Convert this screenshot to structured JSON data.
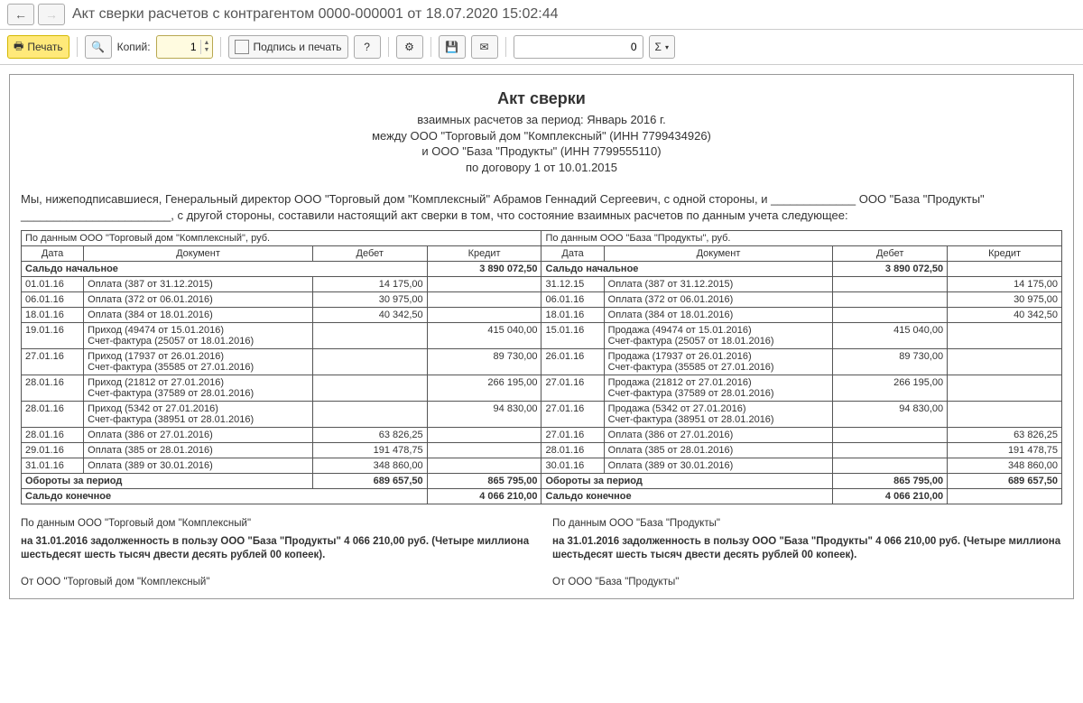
{
  "titlebar": {
    "title": "Акт сверки расчетов с контрагентом 0000-000001 от 18.07.2020 15:02:44"
  },
  "toolbar": {
    "print_label": "Печать",
    "copies_label": "Копий:",
    "copies_value": "1",
    "sign_label": "Подпись и печать",
    "num_value": "0",
    "sigma": "Σ"
  },
  "doc": {
    "title": "Акт сверки",
    "sub1": "взаимных расчетов за период: Январь 2016 г.",
    "sub2": "между ООО \"Торговый дом \"Комплексный\" (ИНН 7799434926)",
    "sub3": "и ООО \"База \"Продукты\" (ИНН 7799555110)",
    "sub4": "по договору 1 от 10.01.2015",
    "intro": "Мы, нижеподписавшиеся, Генеральный директор ООО \"Торговый дом \"Комплексный\" Абрамов Геннадий Сергеевич, с одной стороны, и _____________ ООО \"База \"Продукты\" _______________________, с другой стороны, составили настоящий акт сверки в том, что состояние взаимных расчетов по данным учета следующее:"
  },
  "table": {
    "left_header": "По данным ООО \"Торговый дом \"Комплексный\", руб.",
    "right_header": "По данным ООО \"База \"Продукты\", руб.",
    "col_date": "Дата",
    "col_doc": "Документ",
    "col_debit": "Дебет",
    "col_credit": "Кредит",
    "opening_label": "Сальдо начальное",
    "opening_left": "3 890 072,50",
    "opening_right": "3 890 072,50",
    "rows": [
      {
        "ld": "01.01.16",
        "ldoc": "Оплата (387 от 31.12.2015)",
        "ldeb": "14 175,00",
        "lcred": "",
        "rd": "31.12.15",
        "rdoc": "Оплата (387 от 31.12.2015)",
        "rdeb": "",
        "rcred": "14 175,00"
      },
      {
        "ld": "06.01.16",
        "ldoc": "Оплата (372 от 06.01.2016)",
        "ldeb": "30 975,00",
        "lcred": "",
        "rd": "06.01.16",
        "rdoc": "Оплата (372 от 06.01.2016)",
        "rdeb": "",
        "rcred": "30 975,00"
      },
      {
        "ld": "18.01.16",
        "ldoc": "Оплата (384 от 18.01.2016)",
        "ldeb": "40 342,50",
        "lcred": "",
        "rd": "18.01.16",
        "rdoc": "Оплата (384 от 18.01.2016)",
        "rdeb": "",
        "rcred": "40 342,50"
      },
      {
        "ld": "19.01.16",
        "ldoc": "Приход (49474 от 15.01.2016)\nСчет-фактура (25057 от 18.01.2016)",
        "ldeb": "",
        "lcred": "415 040,00",
        "rd": "15.01.16",
        "rdoc": "Продажа (49474 от 15.01.2016)\nСчет-фактура (25057 от 18.01.2016)",
        "rdeb": "415 040,00",
        "rcred": ""
      },
      {
        "ld": "27.01.16",
        "ldoc": "Приход (17937 от 26.01.2016)\nСчет-фактура (35585 от 27.01.2016)",
        "ldeb": "",
        "lcred": "89 730,00",
        "rd": "26.01.16",
        "rdoc": "Продажа (17937 от 26.01.2016)\nСчет-фактура (35585 от 27.01.2016)",
        "rdeb": "89 730,00",
        "rcred": ""
      },
      {
        "ld": "28.01.16",
        "ldoc": "Приход (21812 от 27.01.2016)\nСчет-фактура (37589 от 28.01.2016)",
        "ldeb": "",
        "lcred": "266 195,00",
        "rd": "27.01.16",
        "rdoc": "Продажа (21812 от 27.01.2016)\nСчет-фактура (37589 от 28.01.2016)",
        "rdeb": "266 195,00",
        "rcred": ""
      },
      {
        "ld": "28.01.16",
        "ldoc": "Приход (5342 от 27.01.2016)\nСчет-фактура (38951 от 28.01.2016)",
        "ldeb": "",
        "lcred": "94 830,00",
        "rd": "27.01.16",
        "rdoc": "Продажа (5342 от 27.01.2016)\nСчет-фактура (38951 от 28.01.2016)",
        "rdeb": "94 830,00",
        "rcred": ""
      },
      {
        "ld": "28.01.16",
        "ldoc": "Оплата (386 от 27.01.2016)",
        "ldeb": "63 826,25",
        "lcred": "",
        "rd": "27.01.16",
        "rdoc": "Оплата (386 от 27.01.2016)",
        "rdeb": "",
        "rcred": "63 826,25"
      },
      {
        "ld": "29.01.16",
        "ldoc": "Оплата (385 от 28.01.2016)",
        "ldeb": "191 478,75",
        "lcred": "",
        "rd": "28.01.16",
        "rdoc": "Оплата (385 от 28.01.2016)",
        "rdeb": "",
        "rcred": "191 478,75"
      },
      {
        "ld": "31.01.16",
        "ldoc": "Оплата (389 от 30.01.2016)",
        "ldeb": "348 860,00",
        "lcred": "",
        "rd": "30.01.16",
        "rdoc": "Оплата (389 от 30.01.2016)",
        "rdeb": "",
        "rcred": "348 860,00"
      }
    ],
    "turnover_label": "Обороты за период",
    "turnover_left_deb": "689 657,50",
    "turnover_left_cred": "865 795,00",
    "turnover_right_deb": "865 795,00",
    "turnover_right_cred": "689 657,50",
    "closing_label": "Сальдо конечное",
    "closing_left": "4 066 210,00",
    "closing_right": "4 066 210,00"
  },
  "footer": {
    "left_lead": "По данным ООО \"Торговый дом \"Комплексный\"",
    "left_debt": "на 31.01.2016 задолженность в пользу ООО \"База \"Продукты\" 4 066 210,00 руб. (Четыре миллиона шестьдесят шесть тысяч двести десять рублей 00 копеек).",
    "left_from": "От ООО \"Торговый дом \"Комплексный\"",
    "right_lead": "По данным ООО \"База \"Продукты\"",
    "right_debt": "на 31.01.2016 задолженность в пользу ООО \"База \"Продукты\" 4 066 210,00 руб. (Четыре миллиона шестьдесят шесть тысяч двести десять рублей 00 копеек).",
    "right_from": "От ООО \"База \"Продукты\""
  }
}
